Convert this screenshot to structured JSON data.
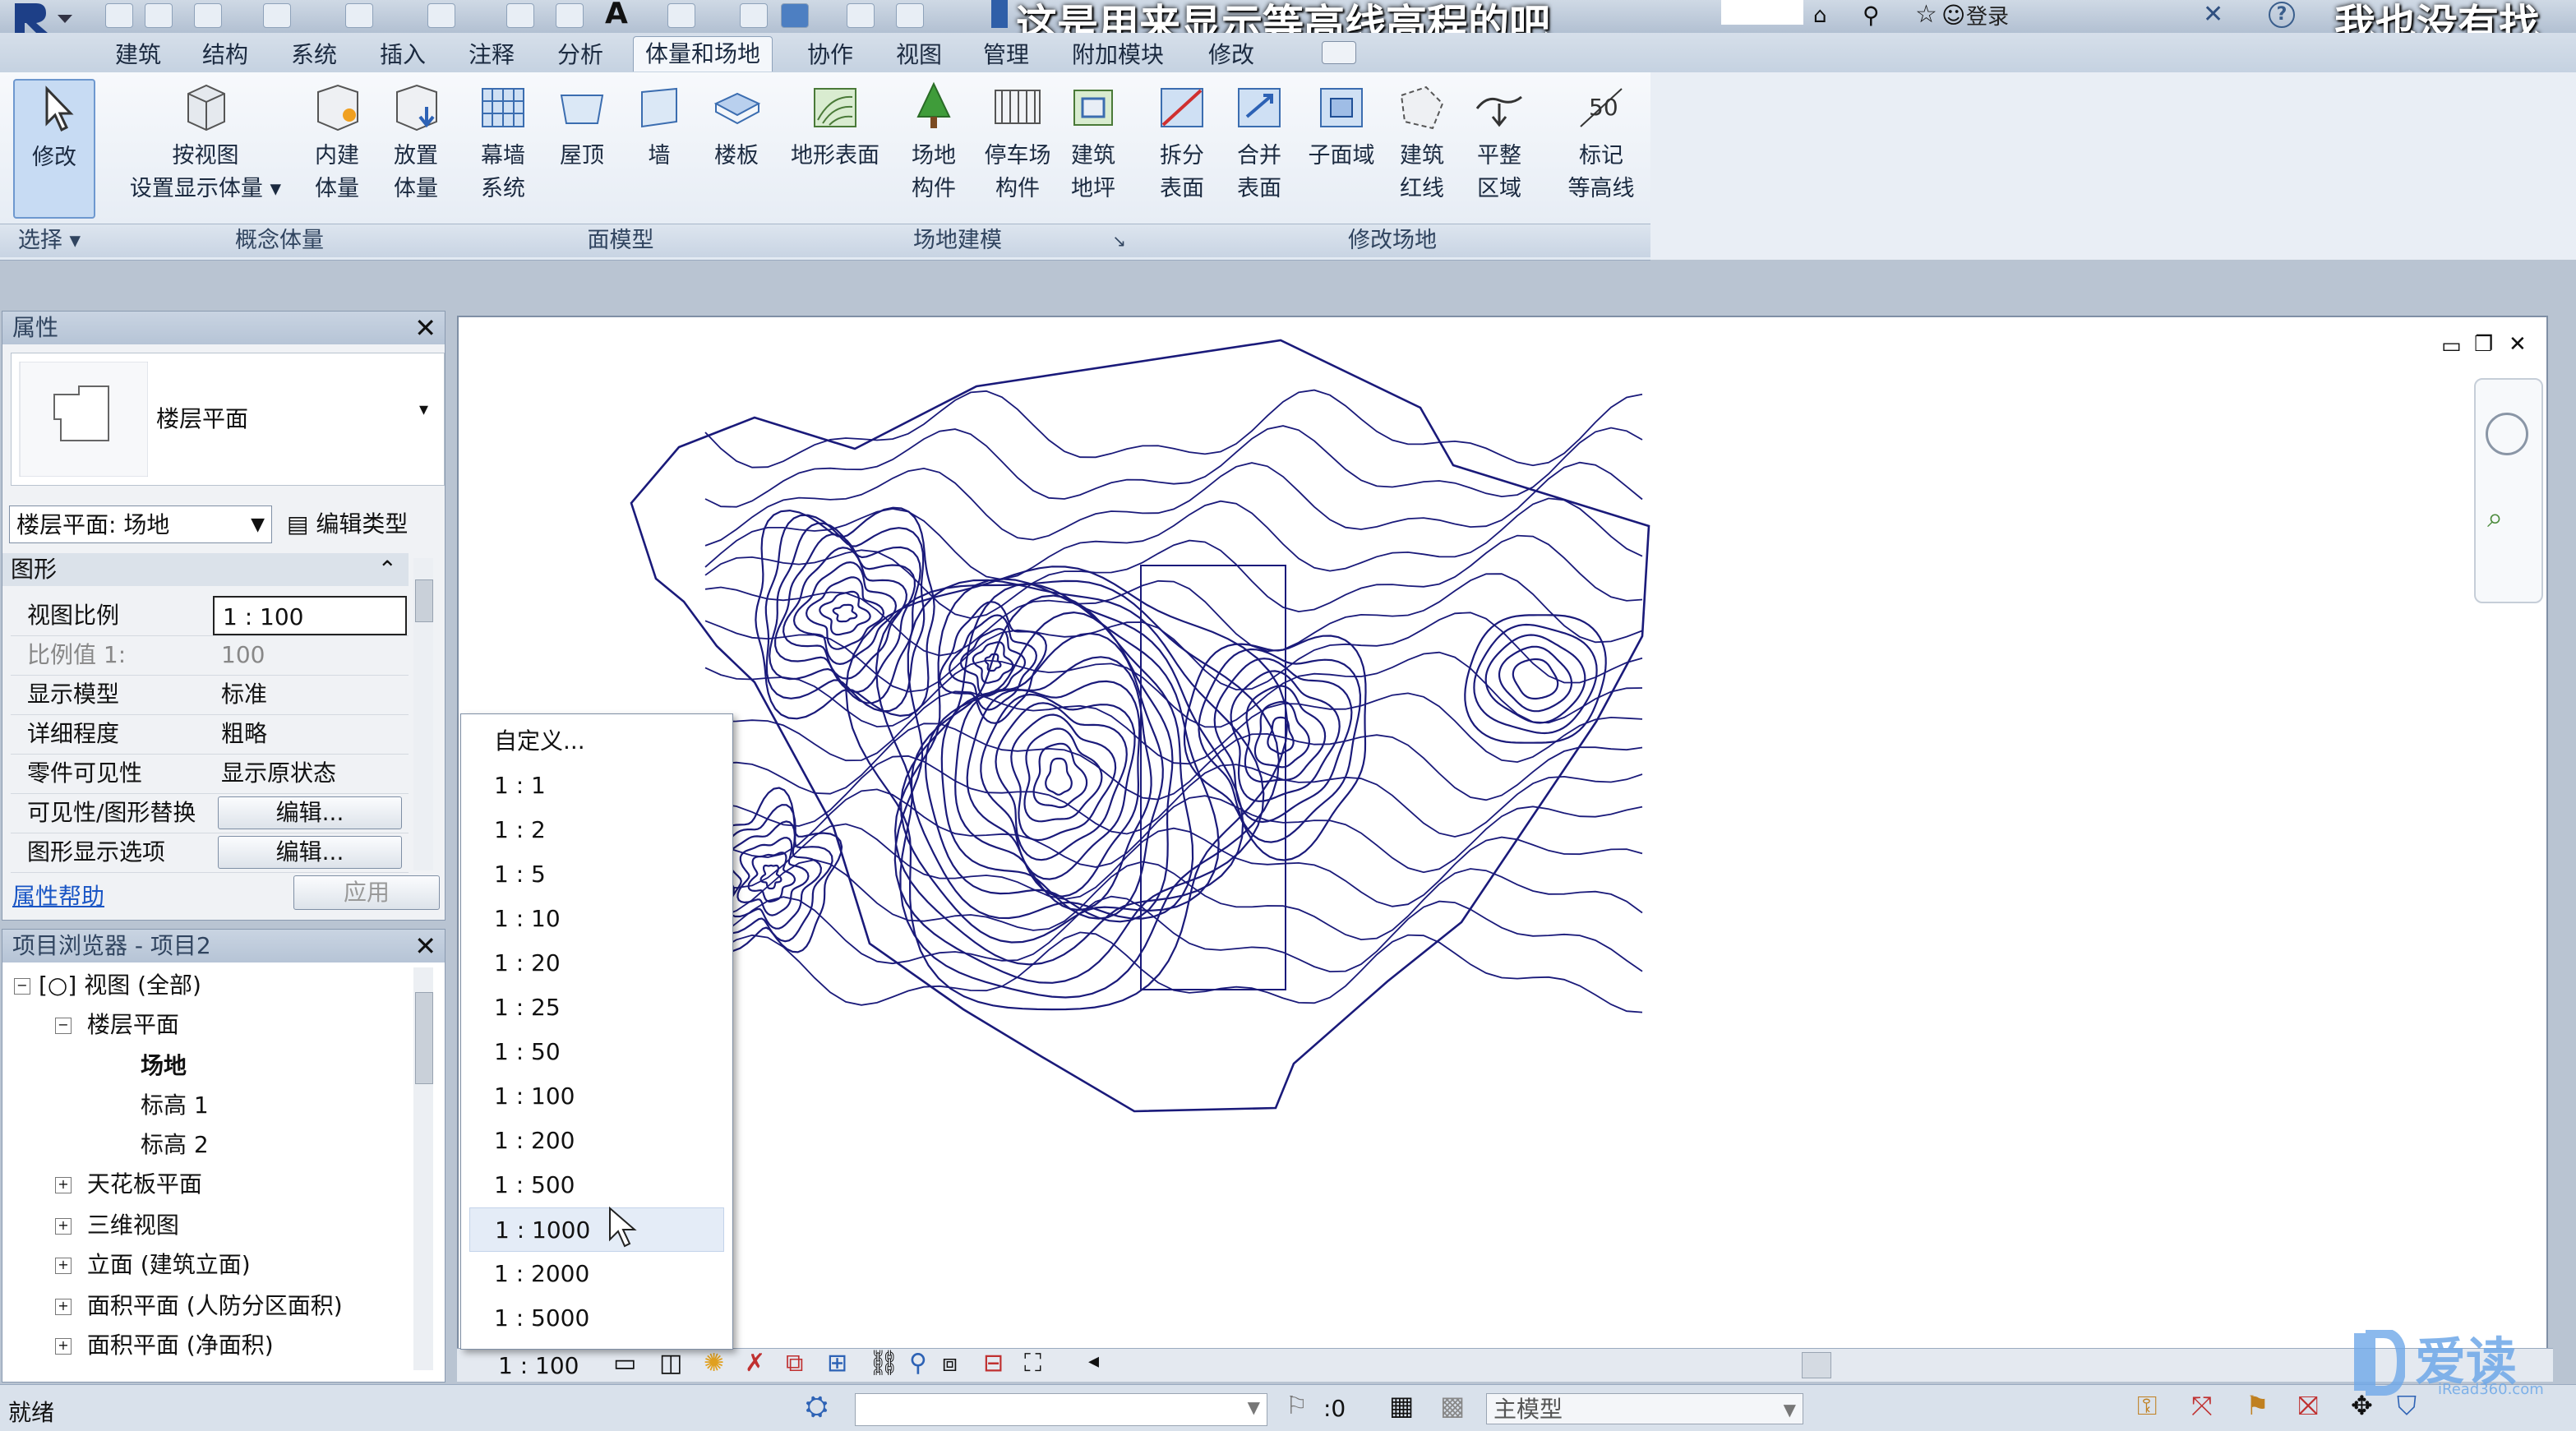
{
  "subtitles": {
    "left": "这是用来显示等高线高程的吧",
    "right": "我也没有找"
  },
  "titlebar": {
    "signin": "登录"
  },
  "tabs": [
    "建筑",
    "结构",
    "系统",
    "插入",
    "注释",
    "分析",
    "体量和场地",
    "协作",
    "视图",
    "管理",
    "附加模块",
    "修改"
  ],
  "ribbon": {
    "modify": "修改",
    "select": "选择",
    "buttons": {
      "show_mass": [
        "按视图",
        "设置显示体量"
      ],
      "inplace_mass": [
        "内建",
        "体量"
      ],
      "place_mass": [
        "放置",
        "体量"
      ],
      "curtain": [
        "幕墙",
        "系统"
      ],
      "roof": "屋顶",
      "wall": "墙",
      "floor": "楼板",
      "toposurface": "地形表面",
      "site_component": [
        "场地",
        "构件"
      ],
      "parking": [
        "停车场",
        "构件"
      ],
      "pad": [
        "建筑",
        "地坪"
      ],
      "split": [
        "拆分",
        "表面"
      ],
      "merge": [
        "合并",
        "表面"
      ],
      "subregion": "子面域",
      "property_line": [
        "建筑",
        "红线"
      ],
      "graded_region": [
        "平整",
        "区域"
      ],
      "label_contours": [
        "标记",
        "等高线"
      ],
      "label_number": "50"
    },
    "panels": {
      "conceptual": "概念体量",
      "face_model": "面模型",
      "site_modeling": "场地建模",
      "modify_site": "修改场地"
    }
  },
  "properties": {
    "title": "属性",
    "type_name": "楼层平面",
    "instance_selector": "楼层平面: 场地",
    "edit_type": "编辑类型",
    "section": "图形",
    "rows": [
      {
        "k": "视图比例",
        "v": "1 : 100"
      },
      {
        "k": "比例值 1:",
        "v": "100"
      },
      {
        "k": "显示模型",
        "v": "标准"
      },
      {
        "k": "详细程度",
        "v": "粗略"
      },
      {
        "k": "零件可见性",
        "v": "显示原状态"
      },
      {
        "k": "可见性/图形替换",
        "v": "编辑..."
      },
      {
        "k": "图形显示选项",
        "v": "编辑..."
      }
    ],
    "help": "属性帮助",
    "apply": "应用"
  },
  "browser": {
    "title": "项目浏览器 - 项目2",
    "items": [
      "视图 (全部)",
      "楼层平面",
      "场地",
      "标高 1",
      "标高 2",
      "天花板平面",
      "三维视图",
      "立面 (建筑立面)",
      "面积平面 (人防分区面积)",
      "面积平面 (净面积)"
    ]
  },
  "scale_menu": [
    "自定义...",
    "1 : 1",
    "1 : 2",
    "1 : 5",
    "1 : 10",
    "1 : 20",
    "1 : 25",
    "1 : 50",
    "1 : 100",
    "1 : 200",
    "1 : 500",
    "1 : 1000",
    "1 : 2000",
    "1 : 5000"
  ],
  "view_control": {
    "scale": "1 : 100"
  },
  "status": {
    "ready": "就绪",
    "selection_count": ":0",
    "model": "主模型"
  },
  "watermark": {
    "brand": "爱读",
    "url": "iRead360.com"
  },
  "colors": {
    "contour": "#1a1a7a",
    "ribbon_accent": "#3f74b8"
  }
}
